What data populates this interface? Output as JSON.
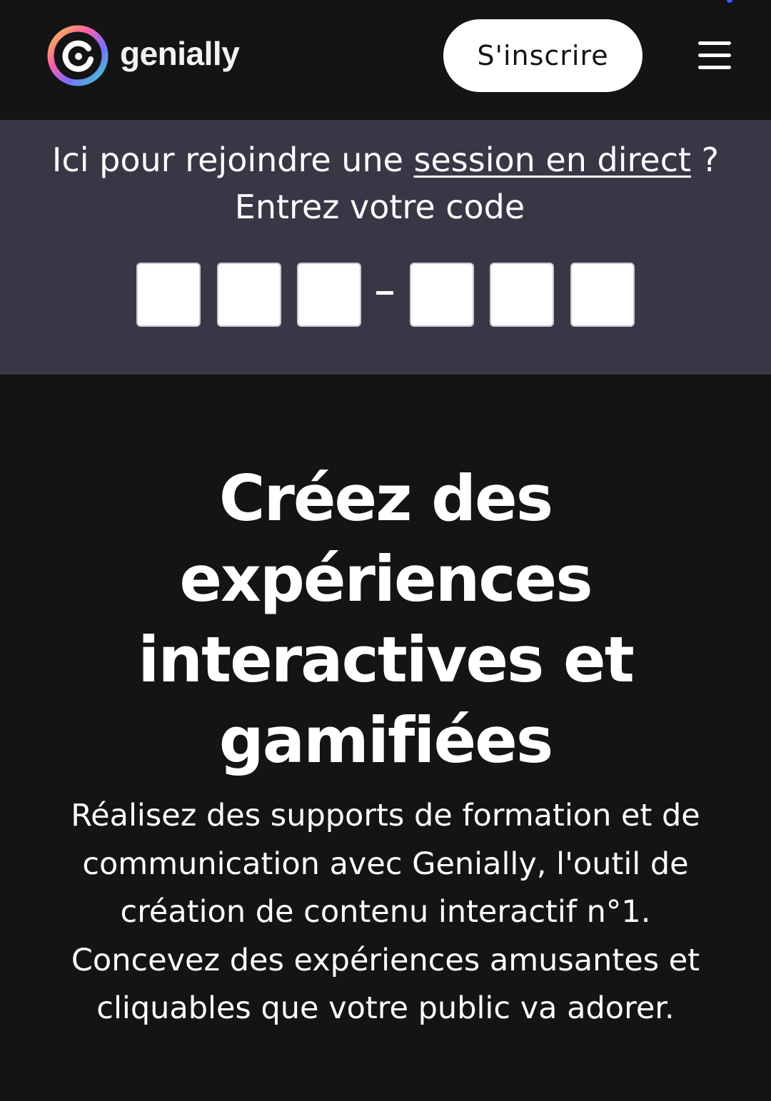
{
  "header": {
    "logo_text": "genially",
    "signup_label": "S'inscrire"
  },
  "session": {
    "prefix": "Ici pour rejoindre une ",
    "link_text": "session en direct",
    "suffix": " ?",
    "code_prompt": "Entrez votre code",
    "code_separator": "-"
  },
  "hero": {
    "title": "Créez des expériences interactives et gamifiées",
    "description": "Réalisez des supports de formation et de communication avec Genially, l'outil de création de contenu interactif n°1. Concevez des expériences amusantes et cliquables que votre public va adorer."
  },
  "colors": {
    "background": "#141416",
    "session_band": "#383746",
    "accent_blue": "#3d5afe"
  }
}
